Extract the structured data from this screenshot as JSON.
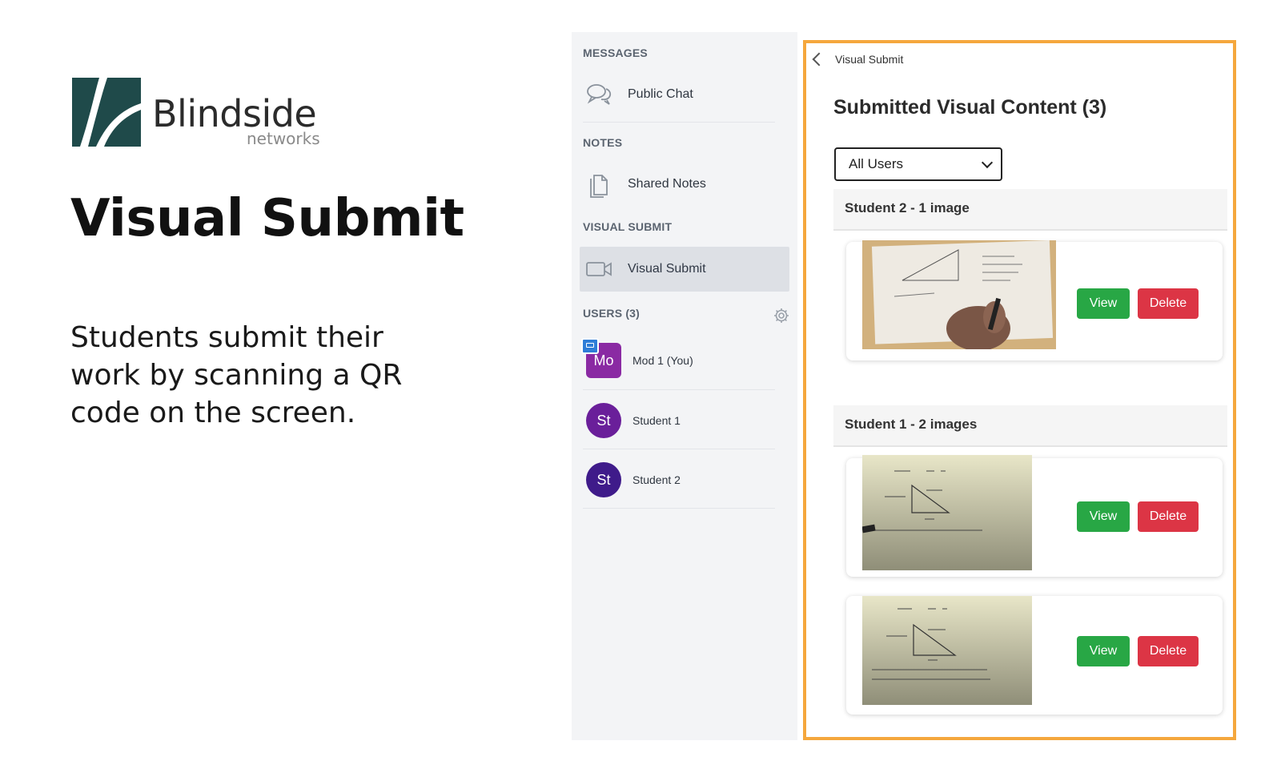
{
  "promo": {
    "logo_word": "Blindside",
    "logo_sub": "networks",
    "title": "Visual Submit",
    "description": "Students submit their work by scanning a QR code on the screen."
  },
  "sidebar": {
    "messages_label": "MESSAGES",
    "public_chat": "Public Chat",
    "notes_label": "NOTES",
    "shared_notes": "Shared Notes",
    "visual_submit_label": "VISUAL SUBMIT",
    "visual_submit_item": "Visual Submit",
    "users_label": "USERS (3)",
    "users": [
      {
        "initials": "Mo",
        "name": "Mod 1 (You)"
      },
      {
        "initials": "St",
        "name": "Student 1"
      },
      {
        "initials": "St",
        "name": "Student 2"
      }
    ]
  },
  "panel": {
    "back_label": "Visual Submit",
    "title": "Submitted Visual Content (3)",
    "filter_value": "All Users",
    "groups": [
      {
        "header": "Student 2 - 1 image"
      },
      {
        "header": "Student 1 - 2 images"
      }
    ],
    "view_label": "View",
    "delete_label": "Delete"
  },
  "colors": {
    "panel_border": "#f5a73d",
    "view_button": "#28a745",
    "delete_button": "#dc3545",
    "logo_mark": "#1f4a4a"
  }
}
